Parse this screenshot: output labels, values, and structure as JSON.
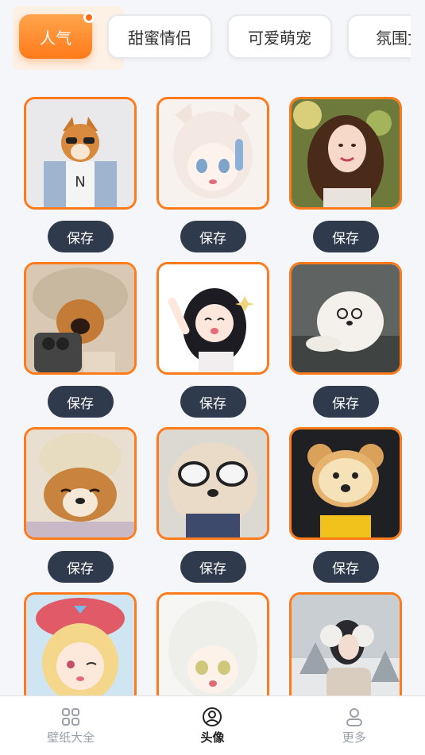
{
  "tabs": [
    {
      "label": "人气",
      "active": true
    },
    {
      "label": "甜蜜情侣",
      "active": false
    },
    {
      "label": "可爱萌宠",
      "active": false
    },
    {
      "label": "氛围女",
      "active": false
    }
  ],
  "grid": {
    "save_label": "保存",
    "items": [
      {
        "subject": "shiba-in-sunglasses-and-shirt"
      },
      {
        "subject": "anime-catgirl-white-hair"
      },
      {
        "subject": "girl-long-brown-hair"
      },
      {
        "subject": "shiba-in-bunny-hood-with-phone"
      },
      {
        "subject": "anime-girl-black-hair"
      },
      {
        "subject": "white-pomeranian-glasses"
      },
      {
        "subject": "shiba-in-knit-hat"
      },
      {
        "subject": "dog-with-white-goggles"
      },
      {
        "subject": "dog-with-bread-face"
      },
      {
        "subject": "anime-girl-blonde-bow"
      },
      {
        "subject": "anime-girl-white-hair"
      },
      {
        "subject": "girl-with-earmuffs-snow"
      }
    ]
  },
  "bottom_nav": [
    {
      "label": "壁纸大全",
      "icon": "grid-icon",
      "active": false
    },
    {
      "label": "头像",
      "icon": "avatar-icon",
      "active": true
    },
    {
      "label": "更多",
      "icon": "person-icon",
      "active": false
    }
  ],
  "colors": {
    "accent": "#ff7a1a",
    "button": "#2f3a4d",
    "background": "#f4f6f9"
  }
}
